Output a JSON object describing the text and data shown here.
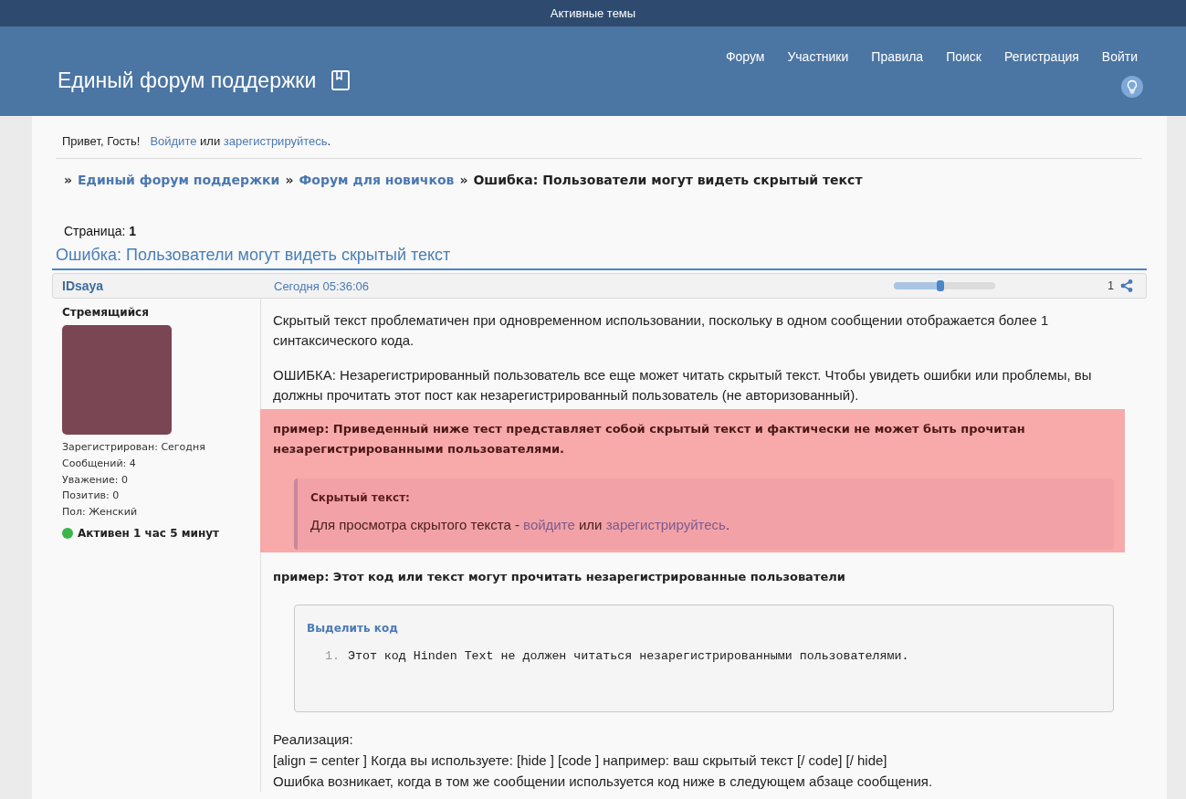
{
  "top_bar": {
    "link": "Активные темы"
  },
  "header": {
    "title": "Единый форум поддержки",
    "nav": [
      "Форум",
      "Участники",
      "Правила",
      "Поиск",
      "Регистрация",
      "Войти"
    ]
  },
  "welcome": {
    "greeting": "Привет, Гость!",
    "prompt": [
      {
        "kind": "login_link",
        "text": "Войдите"
      },
      {
        "kind": "text",
        "text": " или "
      },
      {
        "kind": "register_link",
        "text": "зарегистрируйтесь"
      },
      {
        "kind": "text",
        "text": "."
      }
    ]
  },
  "breadcrumb": [
    {
      "separator": "»",
      "label": "Единый форум поддержки",
      "kind": "link"
    },
    {
      "separator": "»",
      "label": "Форум для новичков",
      "kind": "link"
    },
    {
      "separator": "»",
      "label": "Ошибка: Пользователи могут видеть скрытый текст",
      "kind": "current"
    }
  ],
  "pagination": {
    "text": "Страница: **1**"
  },
  "topic_title": "Ошибка: Пользователи могут видеть скрытый текст",
  "post": {
    "author": "IDsaya",
    "date": "Сегодня 05:36:06",
    "slider": {
      "level": 0.46
    },
    "number": "1",
    "user": {
      "rank": "Стремящийся",
      "stats": [
        "Зарегистрирован: Сегодня",
        "Сообщений: 4",
        "Уважение: 0",
        "Позитив: 0",
        "Пол: Женский"
      ],
      "status": {
        "online": true,
        "text": "Активен 1 час 5 минут"
      }
    },
    "body": [
      {
        "kind": "paragraph",
        "text": "Скрытый текст проблематичен при одновременном использовании, поскольку в одном сообщении отображается более 1 синтаксического кода."
      },
      {
        "kind": "paragraph",
        "text": "ОШИБКА: Незарегистрированный пользователь все еще может читать скрытый текст. Чтобы увидеть ошибки или проблемы, вы должны прочитать этот пост как незарегистрированный пользователь (не авторизованный)."
      },
      {
        "kind": "alert",
        "text": "пример: Приведенный ниже тест представляет собой скрытый текст и фактически не может быть прочитан незарегистрированными пользователями.",
        "hidden": {
          "title": "Скрытый текст:",
          "message": [
            {
              "kind": "text",
              "text": "Для просмотра скрытого текста - "
            },
            {
              "kind": "login_link",
              "text": "войдите"
            },
            {
              "kind": "text",
              "text": " или "
            },
            {
              "kind": "register_link",
              "text": "зарегистрируйтесь"
            },
            {
              "kind": "text",
              "text": "."
            }
          ]
        }
      },
      {
        "kind": "heading",
        "text": "пример: Этот код или текст могут прочитать незарегистрированные пользователи"
      },
      {
        "kind": "code",
        "title": "Выделить код",
        "lines": [
          {
            "number": "1.",
            "text": "Этот код Hinden Text не должен читаться незарегистрированными пользователями."
          }
        ]
      },
      {
        "kind": "lines",
        "lines": [
          "Реализация:",
          "[align = center ] Когда вы используете: [hide ] [code ] например: ваш скрытый текст [/ code] [/ hide]",
          "Ошибка возникает, когда в том же сообщении используется код ниже в следующем абзаце сообщения."
        ]
      }
    ]
  }
}
